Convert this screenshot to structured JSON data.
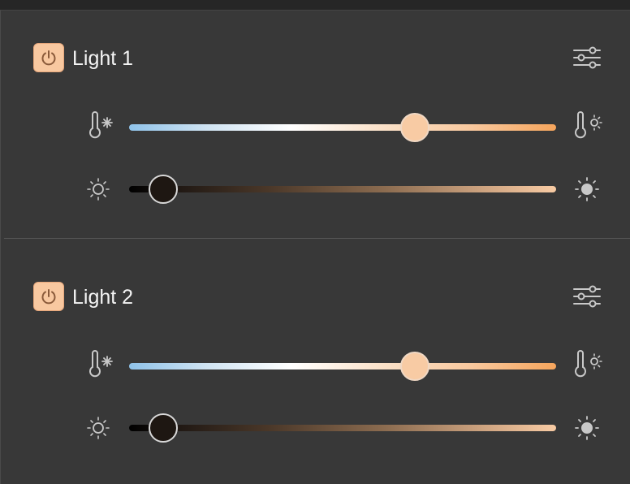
{
  "lights": [
    {
      "name": "Light 1",
      "power": "on",
      "temperature_level": 0.67,
      "brightness_level": 0.08
    },
    {
      "name": "Light 2",
      "power": "on",
      "temperature_level": 0.67,
      "brightness_level": 0.08
    }
  ],
  "icons": {
    "power": "power-icon",
    "settings": "sliders-settings-icon",
    "temp_cool": "thermometer-snowflake-icon",
    "temp_warm": "thermometer-sun-icon",
    "brightness_low": "sun-dim-icon",
    "brightness_high": "sun-bright-icon"
  },
  "colors": {
    "power_button": "#f8c8a0",
    "panel_bg": "#383838",
    "warm_end": "#f6a55c",
    "cool_end": "#8fc3ea"
  }
}
